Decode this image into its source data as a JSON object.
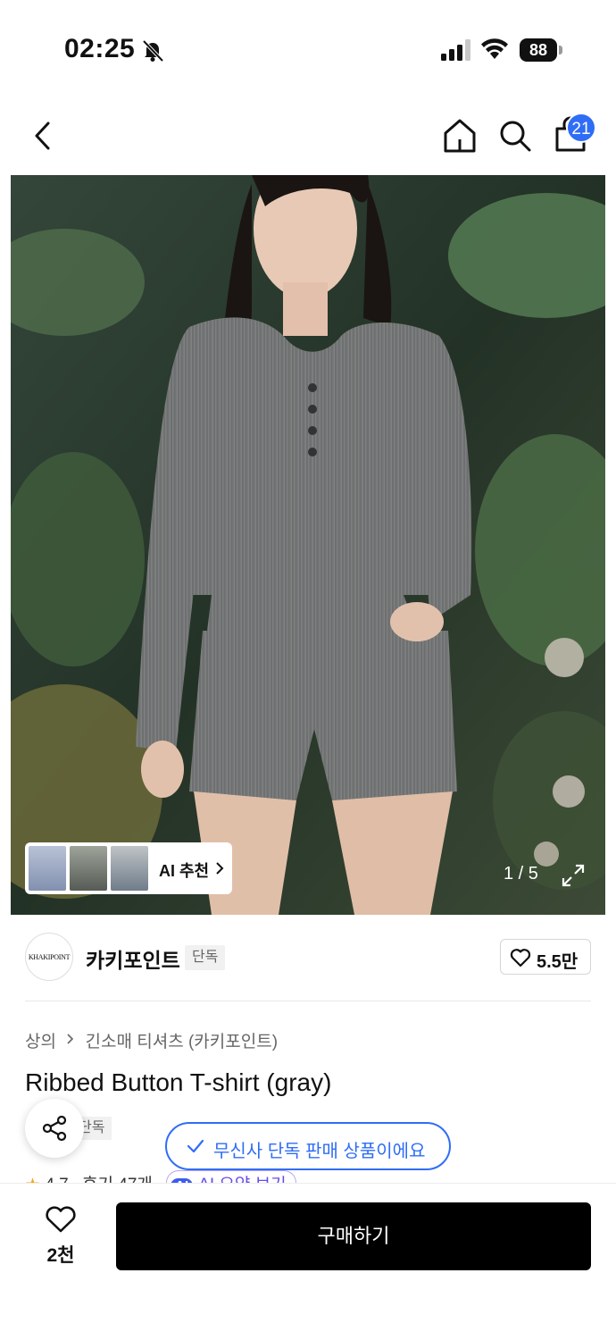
{
  "status_bar": {
    "time": "02:25",
    "battery": "88",
    "icons": [
      "bell-slash-icon",
      "signal-icon",
      "wifi-icon",
      "battery-icon"
    ]
  },
  "nav": {
    "cart_count": "21",
    "icons": [
      "chevron-left-icon",
      "home-icon",
      "search-icon",
      "shopping-bag-icon"
    ]
  },
  "gallery": {
    "ai_recommend_label": "AI 추천",
    "page_indicator": "1 / 5"
  },
  "brand": {
    "logo_text": "KHAKIPOINT",
    "name": "카키포인트",
    "exclusive_tag": "단독",
    "like_count": "5.5만"
  },
  "product": {
    "breadcrumb": [
      "상의",
      "긴소매 티셔츠 (카키포인트)"
    ],
    "title": "Ribbed Button T-shirt (gray)",
    "sub_tag": "단독",
    "rating": "4.7",
    "review_count": "후기 47개",
    "ai_summary_badge": "AI",
    "ai_summary_label": "AI 요약 보기"
  },
  "toast": {
    "text": "무신사 단독 판매 상품이에요"
  },
  "bottom_bar": {
    "wish_count": "2천",
    "buy_label": "구매하기"
  },
  "colors": {
    "accent": "#2f6df6",
    "buy_button": "#000000",
    "star": "#f5a623"
  }
}
